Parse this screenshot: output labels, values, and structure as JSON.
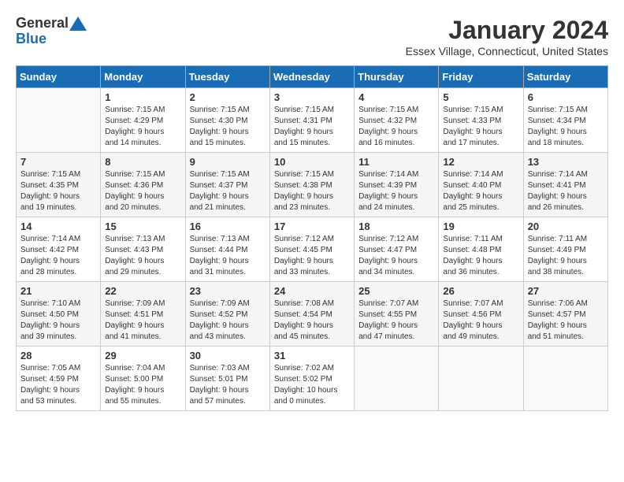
{
  "header": {
    "logo_text_general": "General",
    "logo_text_blue": "Blue",
    "month": "January 2024",
    "location": "Essex Village, Connecticut, United States"
  },
  "days_of_week": [
    "Sunday",
    "Monday",
    "Tuesday",
    "Wednesday",
    "Thursday",
    "Friday",
    "Saturday"
  ],
  "weeks": [
    [
      {
        "day": "",
        "info": ""
      },
      {
        "day": "1",
        "info": "Sunrise: 7:15 AM\nSunset: 4:29 PM\nDaylight: 9 hours\nand 14 minutes."
      },
      {
        "day": "2",
        "info": "Sunrise: 7:15 AM\nSunset: 4:30 PM\nDaylight: 9 hours\nand 15 minutes."
      },
      {
        "day": "3",
        "info": "Sunrise: 7:15 AM\nSunset: 4:31 PM\nDaylight: 9 hours\nand 15 minutes."
      },
      {
        "day": "4",
        "info": "Sunrise: 7:15 AM\nSunset: 4:32 PM\nDaylight: 9 hours\nand 16 minutes."
      },
      {
        "day": "5",
        "info": "Sunrise: 7:15 AM\nSunset: 4:33 PM\nDaylight: 9 hours\nand 17 minutes."
      },
      {
        "day": "6",
        "info": "Sunrise: 7:15 AM\nSunset: 4:34 PM\nDaylight: 9 hours\nand 18 minutes."
      }
    ],
    [
      {
        "day": "7",
        "info": "Sunrise: 7:15 AM\nSunset: 4:35 PM\nDaylight: 9 hours\nand 19 minutes."
      },
      {
        "day": "8",
        "info": "Sunrise: 7:15 AM\nSunset: 4:36 PM\nDaylight: 9 hours\nand 20 minutes."
      },
      {
        "day": "9",
        "info": "Sunrise: 7:15 AM\nSunset: 4:37 PM\nDaylight: 9 hours\nand 21 minutes."
      },
      {
        "day": "10",
        "info": "Sunrise: 7:15 AM\nSunset: 4:38 PM\nDaylight: 9 hours\nand 23 minutes."
      },
      {
        "day": "11",
        "info": "Sunrise: 7:14 AM\nSunset: 4:39 PM\nDaylight: 9 hours\nand 24 minutes."
      },
      {
        "day": "12",
        "info": "Sunrise: 7:14 AM\nSunset: 4:40 PM\nDaylight: 9 hours\nand 25 minutes."
      },
      {
        "day": "13",
        "info": "Sunrise: 7:14 AM\nSunset: 4:41 PM\nDaylight: 9 hours\nand 26 minutes."
      }
    ],
    [
      {
        "day": "14",
        "info": "Sunrise: 7:14 AM\nSunset: 4:42 PM\nDaylight: 9 hours\nand 28 minutes."
      },
      {
        "day": "15",
        "info": "Sunrise: 7:13 AM\nSunset: 4:43 PM\nDaylight: 9 hours\nand 29 minutes."
      },
      {
        "day": "16",
        "info": "Sunrise: 7:13 AM\nSunset: 4:44 PM\nDaylight: 9 hours\nand 31 minutes."
      },
      {
        "day": "17",
        "info": "Sunrise: 7:12 AM\nSunset: 4:45 PM\nDaylight: 9 hours\nand 33 minutes."
      },
      {
        "day": "18",
        "info": "Sunrise: 7:12 AM\nSunset: 4:47 PM\nDaylight: 9 hours\nand 34 minutes."
      },
      {
        "day": "19",
        "info": "Sunrise: 7:11 AM\nSunset: 4:48 PM\nDaylight: 9 hours\nand 36 minutes."
      },
      {
        "day": "20",
        "info": "Sunrise: 7:11 AM\nSunset: 4:49 PM\nDaylight: 9 hours\nand 38 minutes."
      }
    ],
    [
      {
        "day": "21",
        "info": "Sunrise: 7:10 AM\nSunset: 4:50 PM\nDaylight: 9 hours\nand 39 minutes."
      },
      {
        "day": "22",
        "info": "Sunrise: 7:09 AM\nSunset: 4:51 PM\nDaylight: 9 hours\nand 41 minutes."
      },
      {
        "day": "23",
        "info": "Sunrise: 7:09 AM\nSunset: 4:52 PM\nDaylight: 9 hours\nand 43 minutes."
      },
      {
        "day": "24",
        "info": "Sunrise: 7:08 AM\nSunset: 4:54 PM\nDaylight: 9 hours\nand 45 minutes."
      },
      {
        "day": "25",
        "info": "Sunrise: 7:07 AM\nSunset: 4:55 PM\nDaylight: 9 hours\nand 47 minutes."
      },
      {
        "day": "26",
        "info": "Sunrise: 7:07 AM\nSunset: 4:56 PM\nDaylight: 9 hours\nand 49 minutes."
      },
      {
        "day": "27",
        "info": "Sunrise: 7:06 AM\nSunset: 4:57 PM\nDaylight: 9 hours\nand 51 minutes."
      }
    ],
    [
      {
        "day": "28",
        "info": "Sunrise: 7:05 AM\nSunset: 4:59 PM\nDaylight: 9 hours\nand 53 minutes."
      },
      {
        "day": "29",
        "info": "Sunrise: 7:04 AM\nSunset: 5:00 PM\nDaylight: 9 hours\nand 55 minutes."
      },
      {
        "day": "30",
        "info": "Sunrise: 7:03 AM\nSunset: 5:01 PM\nDaylight: 9 hours\nand 57 minutes."
      },
      {
        "day": "31",
        "info": "Sunrise: 7:02 AM\nSunset: 5:02 PM\nDaylight: 10 hours\nand 0 minutes."
      },
      {
        "day": "",
        "info": ""
      },
      {
        "day": "",
        "info": ""
      },
      {
        "day": "",
        "info": ""
      }
    ]
  ]
}
